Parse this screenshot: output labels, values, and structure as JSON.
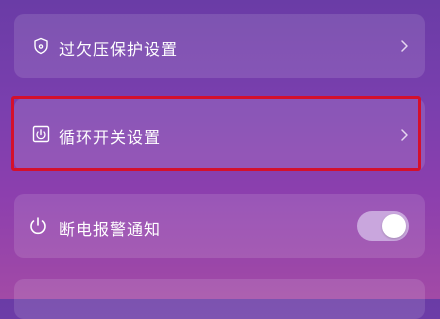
{
  "settings": {
    "items": [
      {
        "label": "过欠压保护设置",
        "icon": "shield-icon",
        "control": "chevron"
      },
      {
        "label": "循环开关设置",
        "icon": "timer-switch-icon",
        "control": "chevron",
        "highlighted": true
      },
      {
        "label": "断电报警通知",
        "icon": "power-icon",
        "control": "toggle",
        "toggle_on": true
      }
    ]
  },
  "colors": {
    "highlight": "#d4102c",
    "toggle_track": "#c9a6dd"
  }
}
